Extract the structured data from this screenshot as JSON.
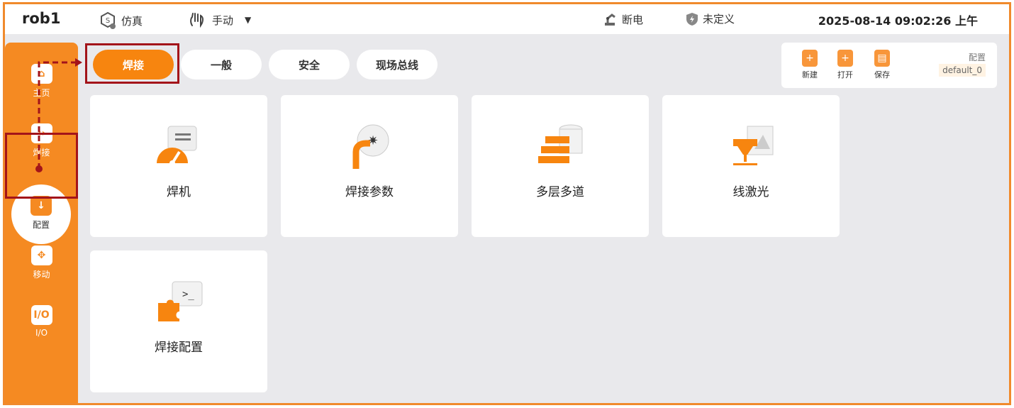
{
  "header": {
    "title": "rob1",
    "sim_label": "仿真",
    "mode_label": "手动",
    "power_label": "断电",
    "undefined_label": "未定义",
    "datetime": "2025-08-14 09:02:26 上午"
  },
  "sidebar": {
    "items": [
      {
        "label": "主页",
        "icon": "home-icon"
      },
      {
        "label": "焊接",
        "icon": "weld-icon"
      },
      {
        "label": "配置",
        "icon": "config-icon"
      },
      {
        "label": "移动",
        "icon": "move-icon"
      },
      {
        "label": "I/O",
        "icon": "io-icon"
      }
    ],
    "io_glyph": "I/O"
  },
  "tabs": [
    {
      "label": "焊接",
      "active": true
    },
    {
      "label": "一般",
      "active": false
    },
    {
      "label": "安全",
      "active": false
    },
    {
      "label": "现场总线",
      "active": false
    }
  ],
  "toolbox": {
    "new_label": "新建",
    "open_label": "打开",
    "save_label": "保存",
    "config_label": "配置",
    "config_value": "default_0"
  },
  "cards": [
    {
      "label": "焊机",
      "icon": "welder-icon"
    },
    {
      "label": "焊接参数",
      "icon": "weld-params-icon"
    },
    {
      "label": "多层多道",
      "icon": "multilayer-icon"
    },
    {
      "label": "线激光",
      "icon": "line-laser-icon"
    },
    {
      "label": "焊接配置",
      "icon": "weld-config-icon"
    }
  ],
  "colors": {
    "accent": "#f7850f",
    "sidebar": "#f58a22",
    "highlight": "#a3141a",
    "background": "#e9e9ec"
  }
}
